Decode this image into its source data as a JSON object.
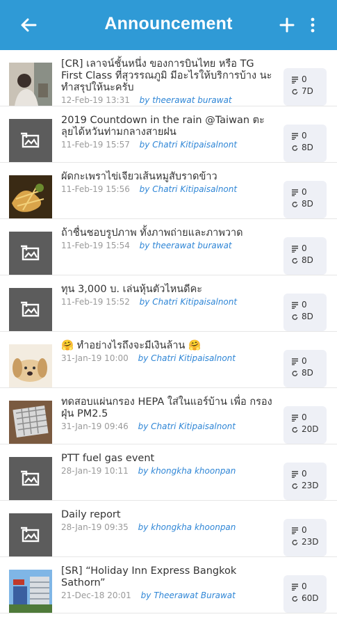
{
  "header": {
    "title": "Announcement",
    "back_icon": "arrow-left-icon",
    "add_icon": "plus-icon",
    "more_icon": "more-vert-icon",
    "bar_color": "#2f9ad6"
  },
  "items": [
    {
      "title": "[CR] เลาจน์ชั้นหนึ่ง ของการบินไทย หรือ TG First Class ที่สุวรรณภูมิ มีอะไรให้บริการบ้าง นะ ทำสรุปให้นะครับ",
      "date": "12-Feb-19 13:31",
      "by": "by theerawat burawat",
      "comments": "0",
      "age": "7D",
      "thumb": "photo-person"
    },
    {
      "title": "2019 Countdown in the rain @Taiwan ตะลุยได้หวันท่ามกลางสายฝน",
      "date": "11-Feb-19 15:57",
      "by": "by Chatri Kitipaisalnont",
      "comments": "0",
      "age": "8D",
      "thumb": "placeholder"
    },
    {
      "title": "ผัดกะเพราไข่เจียวเส้นหมูสับราดข้าว",
      "date": "11-Feb-19 15:56",
      "by": "by Chatri Kitipaisalnont",
      "comments": "0",
      "age": "8D",
      "thumb": "photo-food"
    },
    {
      "title": "ถ้าชื่นชอบรูปภาพ ทั้งภาพถ่ายและภาพวาด",
      "date": "11-Feb-19 15:54",
      "by": "by theerawat burawat",
      "comments": "0",
      "age": "8D",
      "thumb": "placeholder"
    },
    {
      "title": "ทุน 3,000 บ. เล่นหุ้นตัวไหนดีคะ",
      "date": "11-Feb-19 15:52",
      "by": "by Chatri Kitipaisalnont",
      "comments": "0",
      "age": "8D",
      "thumb": "placeholder"
    },
    {
      "title": "🤗 ทำอย่างไรถึงจะมีเงินล้าน 🤗",
      "date": "31-Jan-19 10:00",
      "by": "by Chatri Kitipaisalnont",
      "comments": "0",
      "age": "8D",
      "thumb": "photo-dog"
    },
    {
      "title": "ทดสอบแผ่นกรอง HEPA ใส่ในแอร์บ้าน เพื่อ กรองฝุ่น PM2.5",
      "date": "31-Jan-19 09:46",
      "by": "by Chatri Kitipaisalnont",
      "comments": "0",
      "age": "20D",
      "thumb": "photo-filter"
    },
    {
      "title": "PTT fuel gas event",
      "date": "28-Jan-19 10:11",
      "by": "by khongkha khoonpan",
      "comments": "0",
      "age": "23D",
      "thumb": "placeholder"
    },
    {
      "title": "Daily report",
      "date": "28-Jan-19 09:35",
      "by": "by khongkha khoonpan",
      "comments": "0",
      "age": "23D",
      "thumb": "placeholder"
    },
    {
      "title": "[SR] “Holiday Inn Express Bangkok Sathorn”",
      "date": "21-Dec-18 20:01",
      "by": "by Theerawat Burawat",
      "comments": "0",
      "age": "60D",
      "thumb": "photo-building"
    }
  ]
}
